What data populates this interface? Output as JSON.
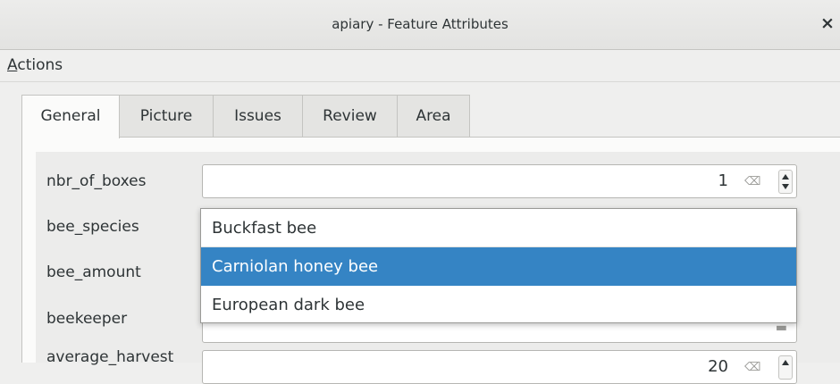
{
  "window": {
    "title": "apiary - Feature Attributes",
    "close_glyph": "×"
  },
  "menu": {
    "actions_mnemonic": "A",
    "actions_rest": "ctions"
  },
  "tabs": [
    {
      "label": "General",
      "active": true
    },
    {
      "label": "Picture",
      "active": false
    },
    {
      "label": "Issues",
      "active": false
    },
    {
      "label": "Review",
      "active": false
    },
    {
      "label": "Area",
      "active": false
    }
  ],
  "form": {
    "fields": [
      {
        "label": "nbr_of_boxes",
        "value": "1"
      },
      {
        "label": "bee_species",
        "value": ""
      },
      {
        "label": "bee_amount",
        "value": ""
      },
      {
        "label": "beekeeper",
        "value": ""
      },
      {
        "label": "average_harvest",
        "value": "20"
      }
    ],
    "clear_glyph": "⌫",
    "combo_arrow": "▬"
  },
  "dropdown": {
    "options": [
      {
        "label": "Buckfast bee",
        "selected": false
      },
      {
        "label": "Carniolan honey bee",
        "selected": true
      },
      {
        "label": "European dark bee",
        "selected": false
      }
    ]
  },
  "colors": {
    "selection": "#3584c4",
    "background": "#efefee"
  }
}
